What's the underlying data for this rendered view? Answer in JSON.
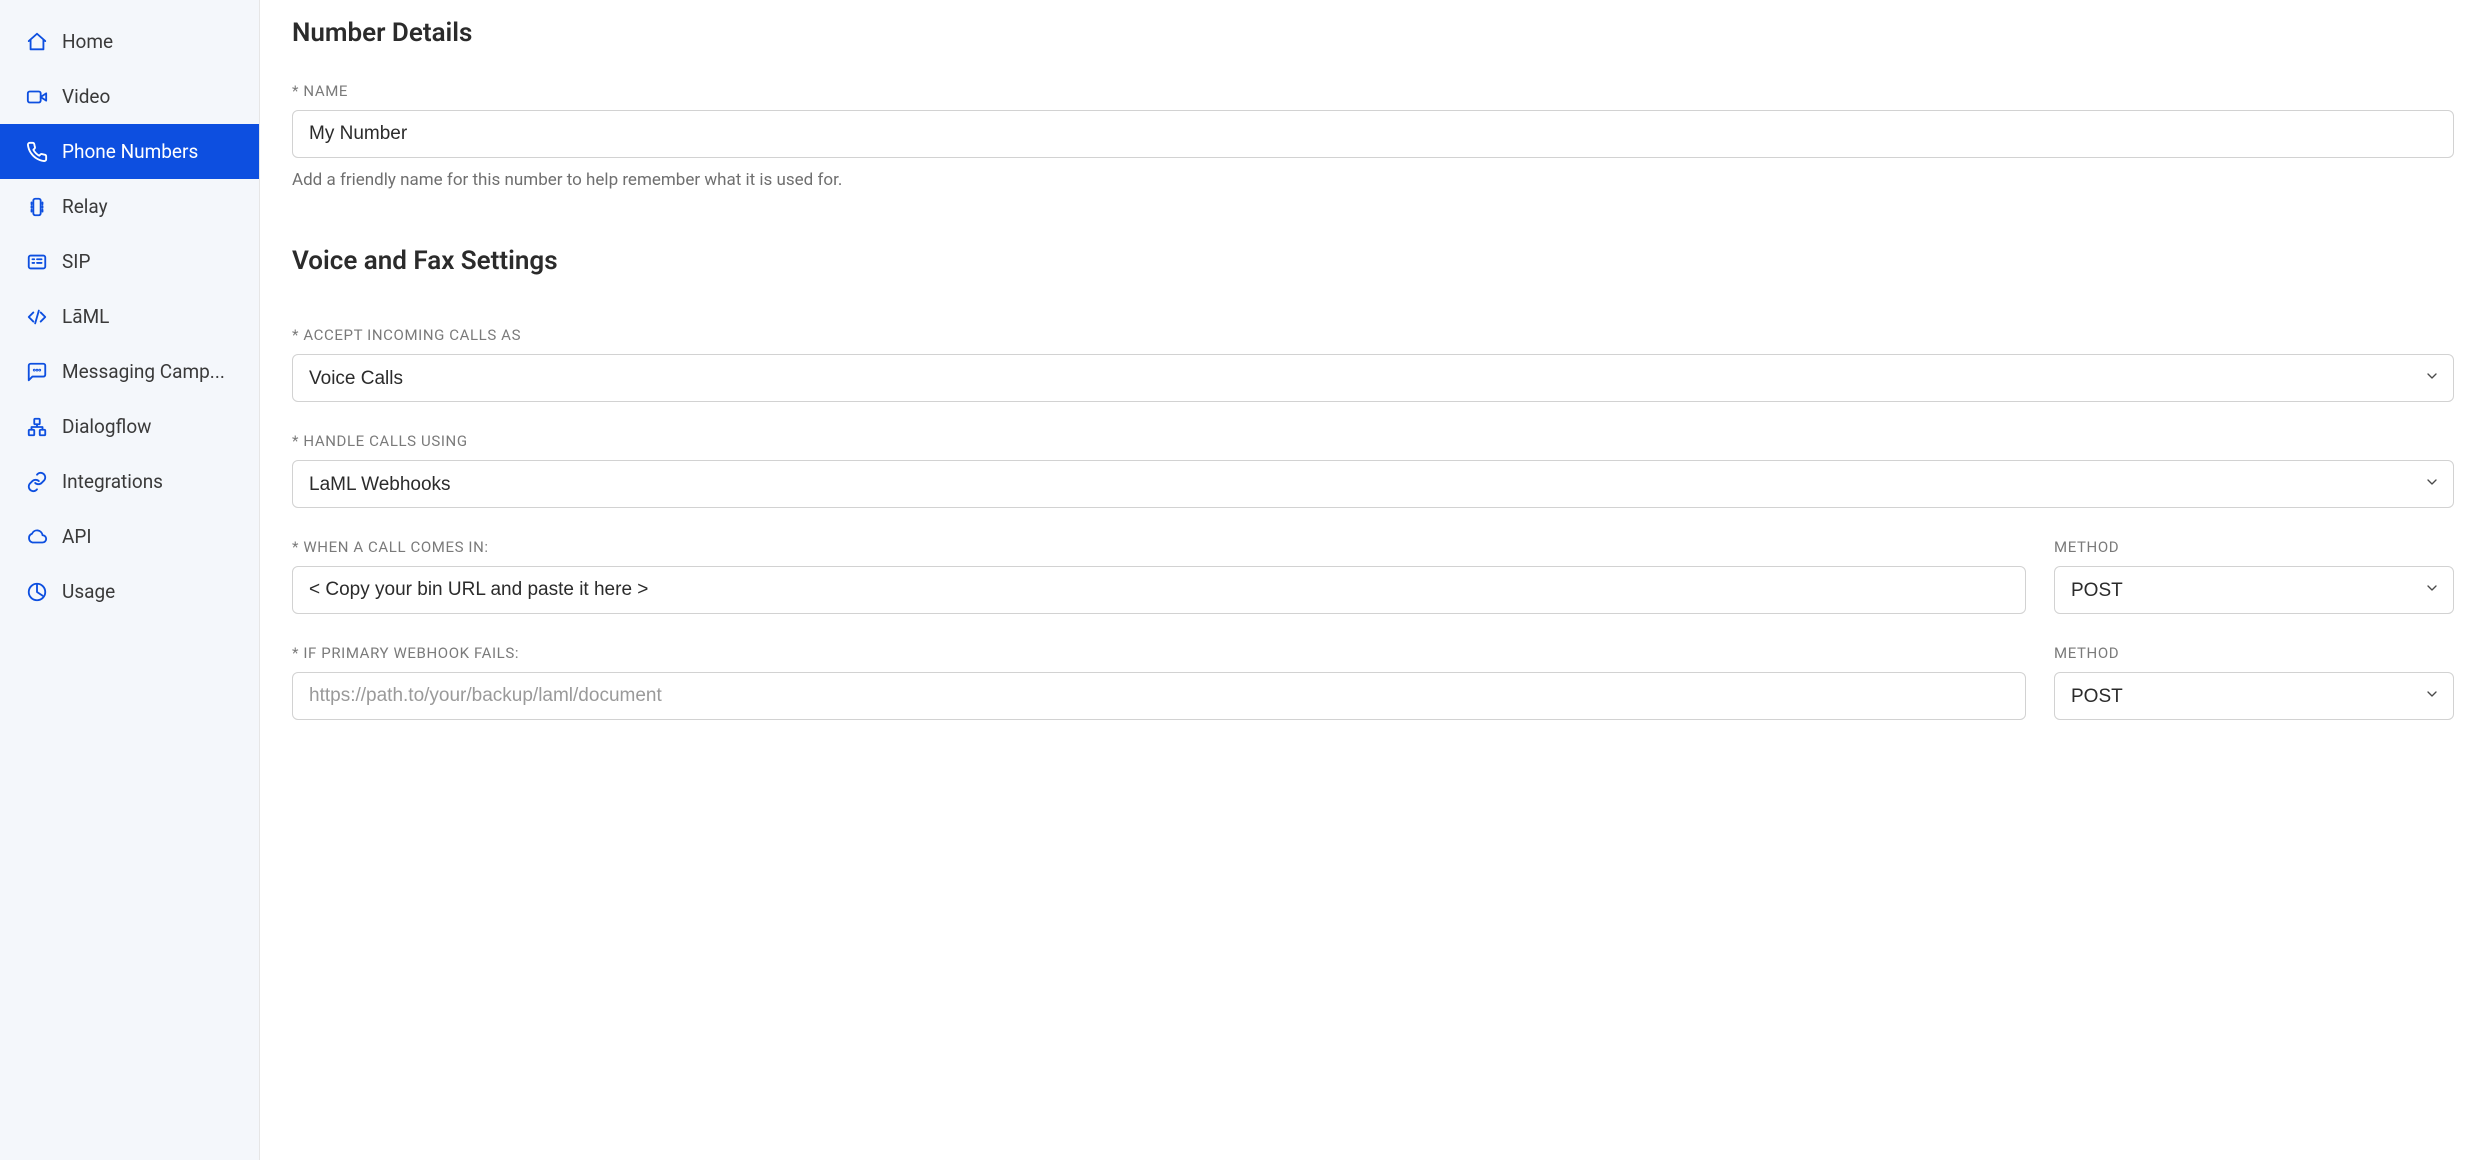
{
  "sidebar": {
    "items": [
      {
        "label": "Home",
        "icon": "home-icon",
        "active": false
      },
      {
        "label": "Video",
        "icon": "video-icon",
        "active": false
      },
      {
        "label": "Phone Numbers",
        "icon": "phone-icon",
        "active": true
      },
      {
        "label": "Relay",
        "icon": "relay-icon",
        "active": false
      },
      {
        "label": "SIP",
        "icon": "sip-icon",
        "active": false
      },
      {
        "label": "LāML",
        "icon": "code-icon",
        "active": false
      },
      {
        "label": "Messaging Camp...",
        "icon": "message-icon",
        "active": false
      },
      {
        "label": "Dialogflow",
        "icon": "dialogflow-icon",
        "active": false
      },
      {
        "label": "Integrations",
        "icon": "link-icon",
        "active": false
      },
      {
        "label": "API",
        "icon": "cloud-icon",
        "active": false
      },
      {
        "label": "Usage",
        "icon": "usage-icon",
        "active": false
      }
    ]
  },
  "sections": {
    "number_details": {
      "title": "Number Details",
      "name_label": "* NAME",
      "name_value": "My Number",
      "name_help": "Add a friendly name for this number to help remember what it is used for."
    },
    "voice_fax": {
      "title": "Voice and Fax Settings",
      "accept_label": "* ACCEPT INCOMING CALLS AS",
      "accept_value": "Voice Calls",
      "handle_label": "* HANDLE CALLS USING",
      "handle_value": "LaML Webhooks",
      "call_in_label": "* WHEN A CALL COMES IN:",
      "call_in_value": "< Copy your bin URL and paste it here >",
      "method_label": "METHOD",
      "method1_value": "POST",
      "fail_label": "* IF PRIMARY WEBHOOK FAILS:",
      "fail_placeholder": "https://path.to/your/backup/laml/document",
      "method2_value": "POST"
    }
  }
}
